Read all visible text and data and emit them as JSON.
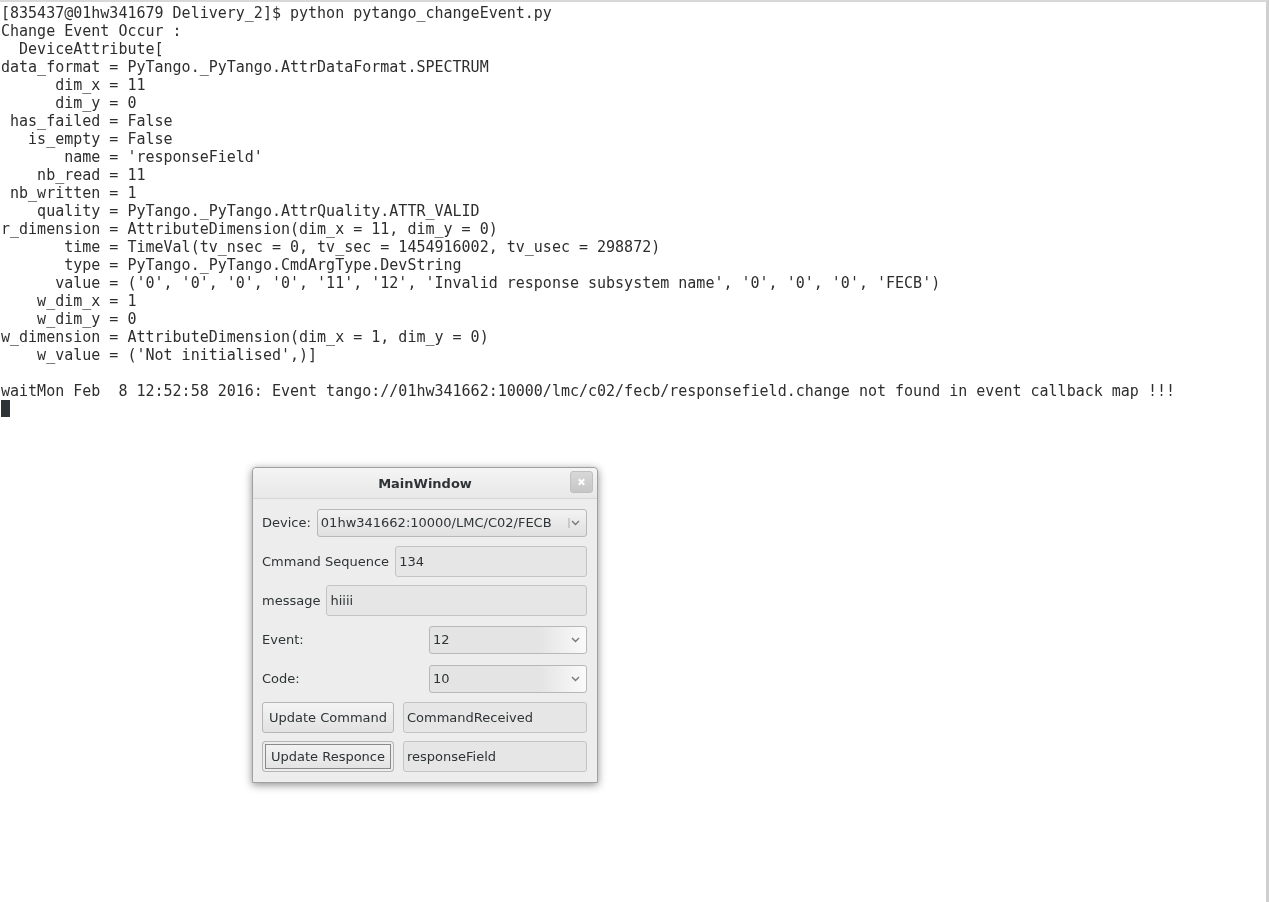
{
  "terminal": {
    "lines": [
      "[835437@01hw341679 Delivery_2]$ python pytango_changeEvent.py",
      "Change Event Occur :",
      "  DeviceAttribute[",
      "data_format = PyTango._PyTango.AttrDataFormat.SPECTRUM",
      "      dim_x = 11",
      "      dim_y = 0",
      " has_failed = False",
      "   is_empty = False",
      "       name = 'responseField'",
      "    nb_read = 11",
      " nb_written = 1",
      "    quality = PyTango._PyTango.AttrQuality.ATTR_VALID",
      "r_dimension = AttributeDimension(dim_x = 11, dim_y = 0)",
      "       time = TimeVal(tv_nsec = 0, tv_sec = 1454916002, tv_usec = 298872)",
      "       type = PyTango._PyTango.CmdArgType.DevString",
      "      value = ('0', '0', '0', '0', '11', '12', 'Invalid response subsystem name', '0', '0', '0', 'FECB')",
      "    w_dim_x = 1",
      "    w_dim_y = 0",
      "w_dimension = AttributeDimension(dim_x = 1, dim_y = 0)",
      "    w_value = ('Not initialised',)]"
    ],
    "notice": "waitMon Feb  8 12:52:58 2016: Event tango://01hw341662:10000/lmc/c02/fecb/responsefield.change not found in event callback map !!!"
  },
  "dialog": {
    "title": "MainWindow",
    "device": {
      "label": "Device:",
      "value": "01hw341662:10000/LMC/C02/FECB"
    },
    "fields": [
      {
        "label": "Cmmand Sequence",
        "value": "134"
      },
      {
        "label": "message",
        "value": "hiiii"
      }
    ],
    "combos": [
      {
        "label": "Event:",
        "value": "12"
      },
      {
        "label": "Code:",
        "value": "10"
      }
    ],
    "actions": [
      {
        "button": "Update Command",
        "focused": false,
        "value": "CommandReceived"
      },
      {
        "button": "Update Responce",
        "focused": true,
        "value": "responseField"
      }
    ]
  }
}
